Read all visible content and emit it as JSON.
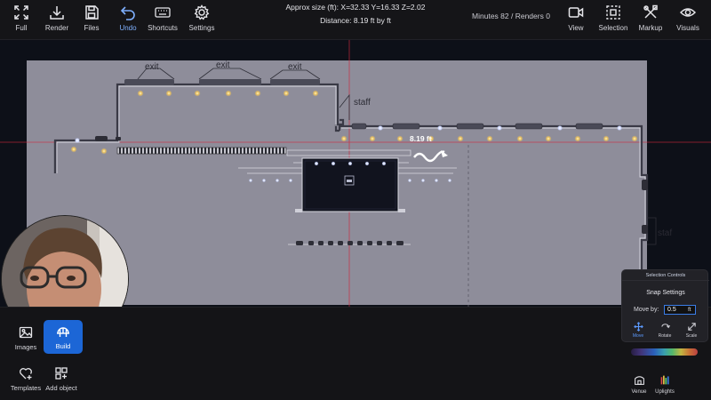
{
  "toolbar": {
    "full_label": "Full",
    "render_label": "Render",
    "files_label": "Files",
    "undo_label": "Undo",
    "shortcuts_label": "Shortcuts",
    "settings_label": "Settings",
    "view_label": "View",
    "selection_label": "Selection",
    "markup_label": "Markup",
    "visuals_label": "Visuals"
  },
  "info": {
    "approx_size": "Approx size (ft):  X=32.33  Y=16.33  Z=2.02",
    "distance": "Distance: 8.19 ft by  ft",
    "stats": "Minutes 82 / Renders 0"
  },
  "canvas": {
    "labels": {
      "exit": "exit",
      "staff": "staff",
      "staff_right": "staf"
    },
    "measurement": "8.19 ft"
  },
  "bottom": {
    "images_label": "Images",
    "build_label": "Build",
    "templates_label": "Templates",
    "add_object_label": "Add object",
    "venue_label": "Venue",
    "uplights_label": "Uplights"
  },
  "selection_panel": {
    "title": "Selection Controls",
    "snap_title": "Snap Settings",
    "move_by_label": "Move by:",
    "move_by_value": "0.5",
    "move_by_unit": "ft",
    "move_label": "Move",
    "rotate_label": "Rotate",
    "scale_label": "Scale"
  },
  "colors": {
    "accent": "#1c66d6",
    "guide_line": "#d0283c",
    "canvas_bg": "#0d1018",
    "floor": "#8a8996"
  }
}
